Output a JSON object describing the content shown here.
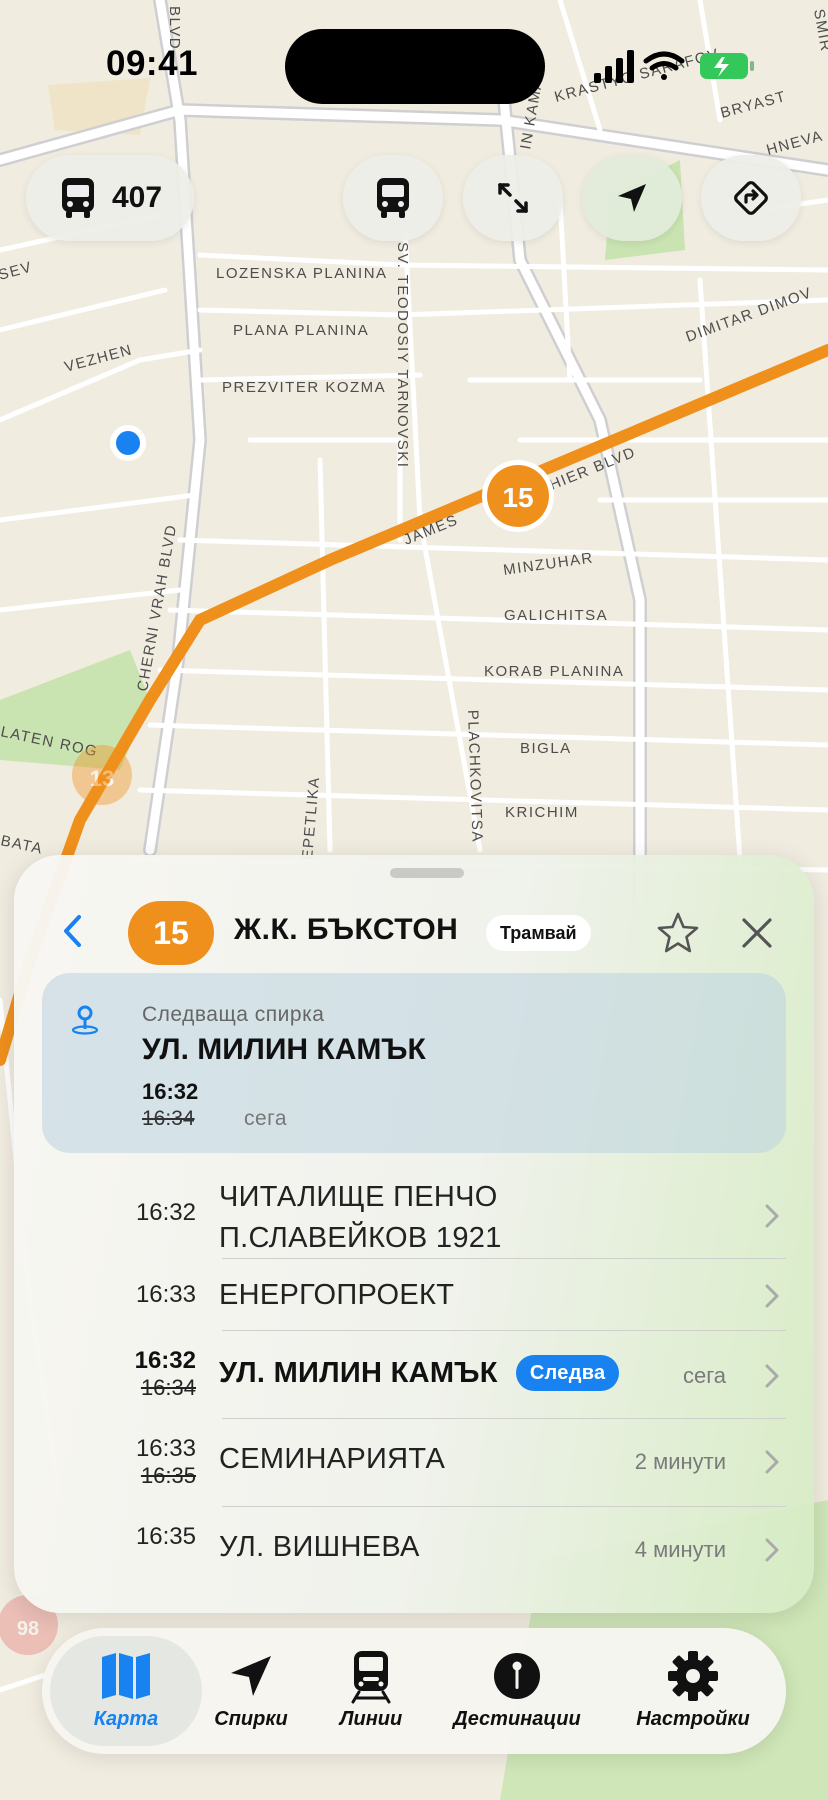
{
  "status_bar": {
    "time": "09:41"
  },
  "map": {
    "route_chip": {
      "icon": "bus-icon",
      "label": "407"
    },
    "controls": [
      "bus-icon",
      "expand-icon",
      "location-arrow-icon",
      "directions-icon"
    ],
    "route_badge": "15",
    "faded_badges": [
      "13",
      "98"
    ],
    "streets": [
      "BLVD",
      "KRASTYO SARAFOV",
      "BRYAST",
      "HNEVA",
      "IN KAMAR",
      "SMIR",
      "SEV",
      "LOZENSKA PLANINA",
      "PLANA PLANINA",
      "VEZHEN",
      "PREZVITER KOZMA",
      "SV. TEODOSIY TARNOVSKI",
      "DIMITAR DIMOV",
      "CHERNI VRAH BLVD",
      "JAMES",
      "HIER BLVD",
      "MINZUHAR",
      "GALICHITSA",
      "KORAB PLANINA",
      "LATEN ROG",
      "BIGLA",
      "PLACHKOVITSA",
      "KRICHIM",
      "EPETLIKA",
      "BATA"
    ],
    "colors": {
      "route": "#f0901c",
      "land": "#f1ece0",
      "road": "#ffffff",
      "park": "#c9e3b1",
      "user_location": "#1782f0"
    }
  },
  "sheet": {
    "line_number": "15",
    "destination": "Ж.К. БЪКСТОН",
    "vehicle_type": "Трамвай",
    "next_stop": {
      "label": "Следваща спирка",
      "name": "УЛ. МИЛИН КАМЪК",
      "time": "16:32",
      "scheduled_time": "16:34",
      "relative": "сега"
    },
    "stops": [
      {
        "time": "16:32",
        "name_line1": "ЧИТАЛИЩЕ ПЕНЧО",
        "name_line2": "П.СЛАВЕЙКОВ 1921"
      },
      {
        "time": "16:33",
        "name": "ЕНЕРГОПРОЕКТ"
      },
      {
        "time": "16:32",
        "scheduled_time": "16:34",
        "name": "УЛ. МИЛИН КАМЪК",
        "badge": "Следва",
        "relative": "сега"
      },
      {
        "time": "16:33",
        "scheduled_time": "16:35",
        "name": "СЕМИНАРИЯТА",
        "relative": "2 минути"
      },
      {
        "time": "16:35",
        "name": "УЛ. ВИШНЕВА",
        "relative": "4 минути"
      }
    ],
    "accent_color": "#1782f0"
  },
  "tabbar": {
    "tabs": [
      {
        "label": "Карта",
        "icon": "map-icon",
        "active": true
      },
      {
        "label": "Спирки",
        "icon": "location-arrow-icon"
      },
      {
        "label": "Линии",
        "icon": "tram-icon"
      },
      {
        "label": "Дестинации",
        "icon": "pin-icon"
      },
      {
        "label": "Настройки",
        "icon": "gear-icon"
      }
    ]
  }
}
